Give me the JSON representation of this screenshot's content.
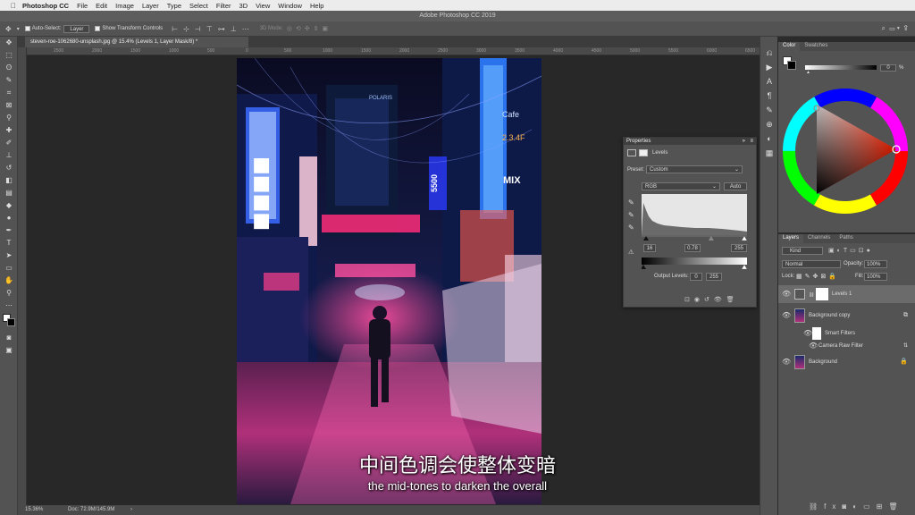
{
  "menubar": {
    "apple": "",
    "app": "Photoshop CC",
    "items": [
      "File",
      "Edit",
      "Image",
      "Layer",
      "Type",
      "Select",
      "Filter",
      "3D",
      "View",
      "Window",
      "Help"
    ]
  },
  "window_title": "Adobe Photoshop CC 2019",
  "options": {
    "auto_select_label": "Auto-Select:",
    "auto_select_value": "Layer",
    "show_transform_label": "Show Transform Controls",
    "mode_3d": "3D Mode:"
  },
  "document": {
    "tab_title": "steven-roe-1062680-unsplash.jpg @ 15.4% (Levels 1, Layer Mask/8) *",
    "ruler_ticks": [
      "2500",
      "2000",
      "1500",
      "1000",
      "500",
      "0",
      "500",
      "1000",
      "1500",
      "2000",
      "2500",
      "3000",
      "3500",
      "4000",
      "4500",
      "5000",
      "5500",
      "6000",
      "6500"
    ]
  },
  "photo_signs": {
    "polaris": "POLARIS",
    "cafe": "Cafe",
    "hours": "2.3.4F",
    "mix": "MIX",
    "num": "5500"
  },
  "status": {
    "zoom": "15.36%",
    "doc": "Doc: 72.9M/145.9M"
  },
  "properties": {
    "title": "Properties",
    "adjustment": "Levels",
    "preset_label": "Preset:",
    "preset_value": "Custom",
    "channel": "RGB",
    "auto": "Auto",
    "input_black": "16",
    "input_mid": "0.78",
    "input_white": "255",
    "output_label": "Output Levels:",
    "output_black": "0",
    "output_white": "255",
    "midtone_fraction": 0.66
  },
  "color_panel": {
    "tabs": [
      "Color",
      "Swatches"
    ],
    "value": "0",
    "unit": "%"
  },
  "layers_panel": {
    "tabs": [
      "Layers",
      "Channels",
      "Paths"
    ],
    "kind": "Kind",
    "blend_mode": "Normal",
    "opacity_label": "Opacity:",
    "opacity": "100%",
    "lock_label": "Lock:",
    "fill_label": "Fill:",
    "fill": "100%",
    "layers": [
      {
        "name": "Levels 1"
      },
      {
        "name": "Background copy"
      },
      {
        "name": "Smart Filters"
      },
      {
        "name": "Camera Raw Filter"
      },
      {
        "name": "Background"
      }
    ]
  },
  "subtitles": {
    "zh": "中间色调会使整体变暗",
    "en": "the mid-tones to darken the overall"
  },
  "colors": {
    "panel": "#535353",
    "dark": "#282828",
    "accent_pink": "#ff2d7a",
    "accent_blue": "#2b6bff"
  }
}
